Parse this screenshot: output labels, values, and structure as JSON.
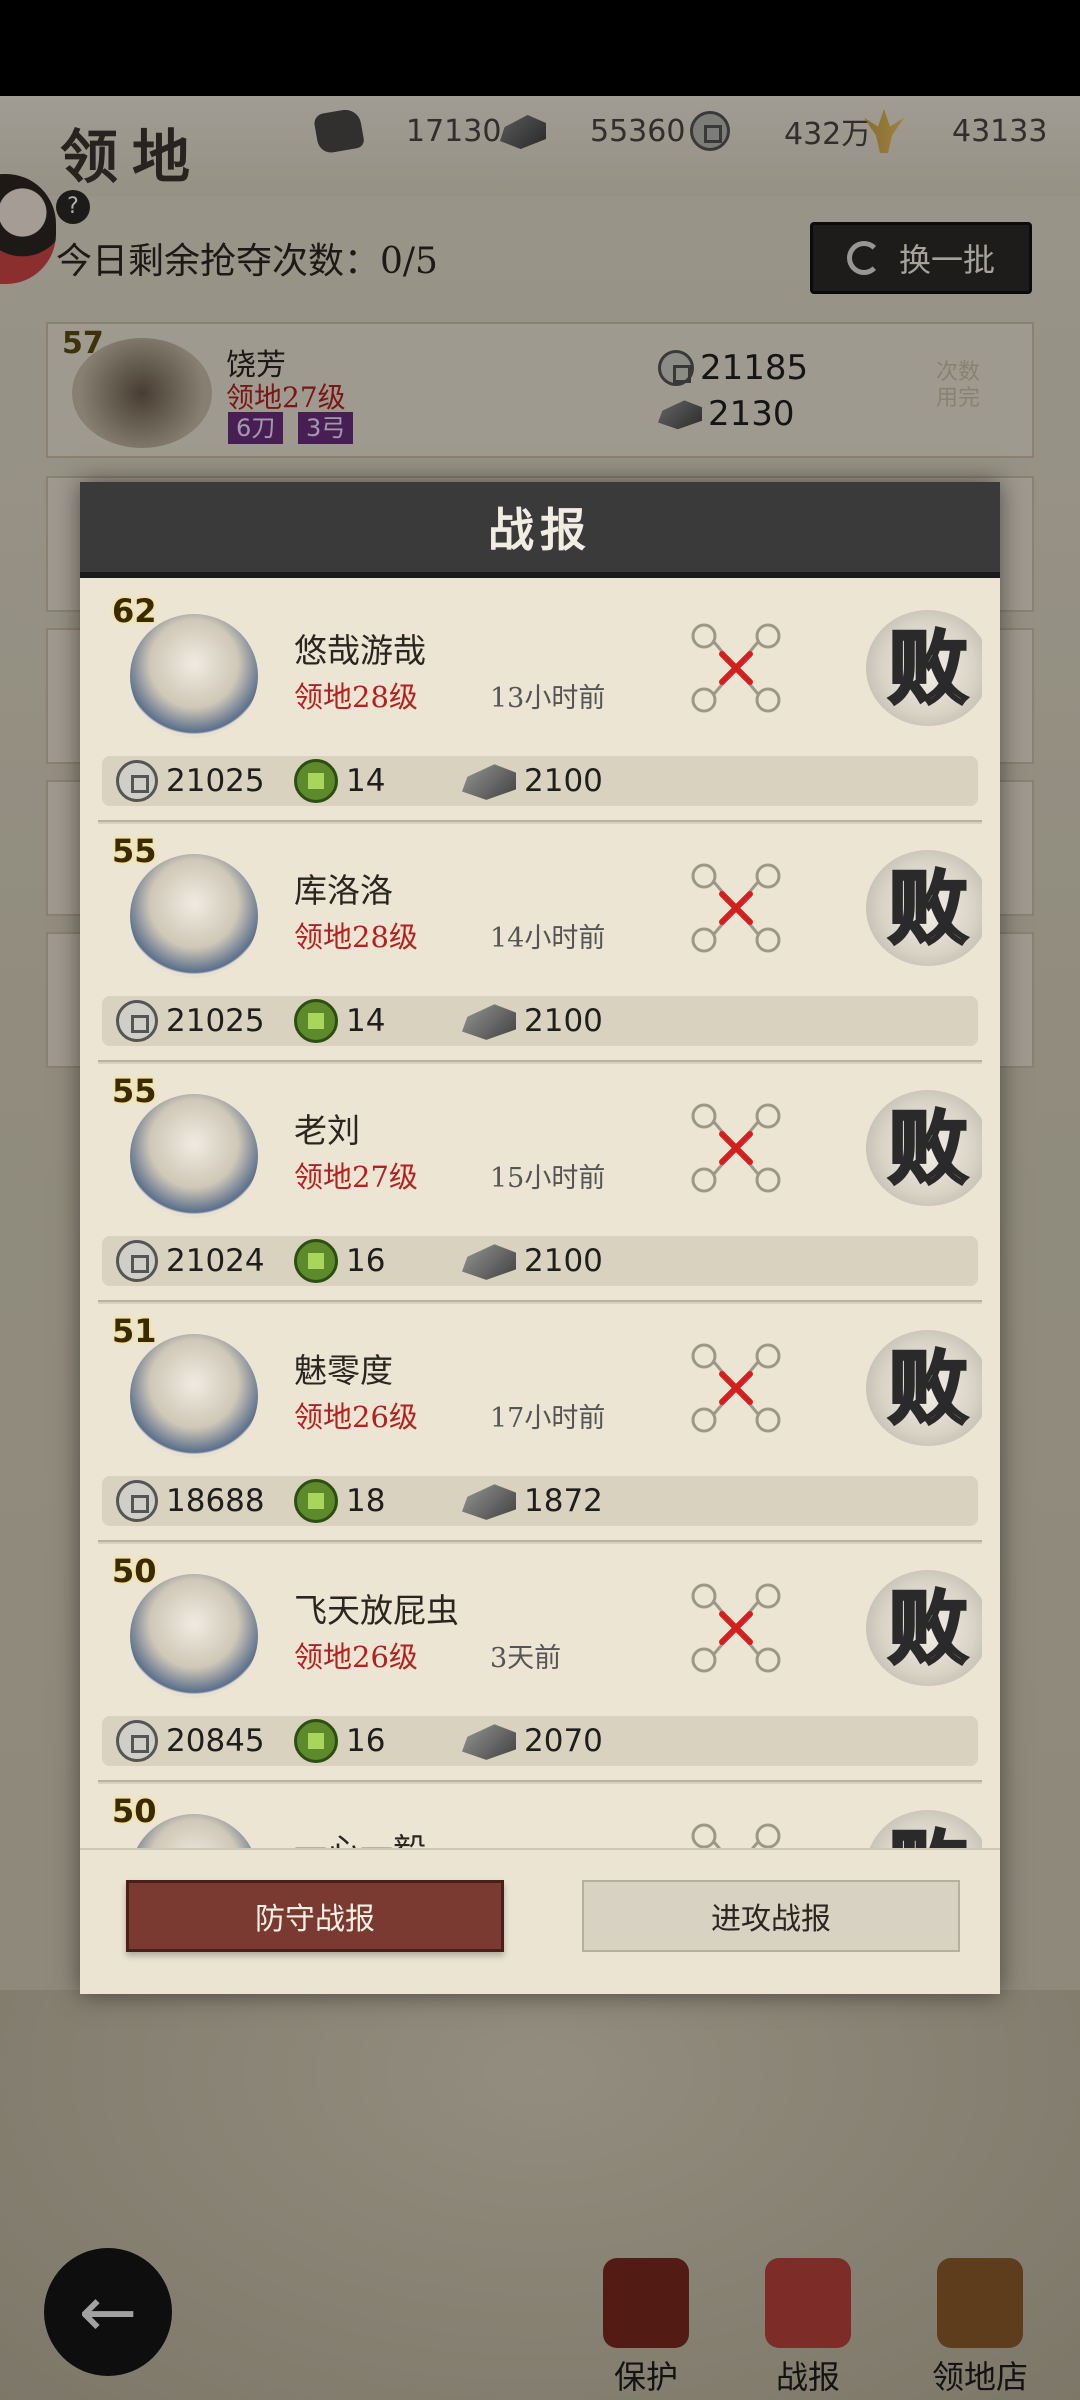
{
  "header": {
    "title": "领地",
    "resources": [
      {
        "icon": "ore-icon",
        "value": "17130"
      },
      {
        "icon": "ingot-icon",
        "value": "55360"
      },
      {
        "icon": "coin-icon",
        "value": "432万"
      },
      {
        "icon": "wheat-icon",
        "value": "43133"
      }
    ],
    "help": "?",
    "attempts_text": "今日剩余抢夺次数：0/5",
    "refresh_label": "换一批"
  },
  "background_row": {
    "level": "57",
    "name": "饶芳",
    "territory": "领地27级",
    "tags": [
      "6刀",
      "3弓"
    ],
    "coins": "21185",
    "ingots": "2130",
    "status": "次数用完"
  },
  "modal": {
    "title": "战报",
    "entries": [
      {
        "level": "62",
        "name": "悠哉游哉",
        "territory": "领地28级",
        "time": "13小时前",
        "result": "败",
        "coins": "21025",
        "jade": "14",
        "ingots": "2100"
      },
      {
        "level": "55",
        "name": "库洛洛",
        "territory": "领地28级",
        "time": "14小时前",
        "result": "败",
        "coins": "21025",
        "jade": "14",
        "ingots": "2100"
      },
      {
        "level": "55",
        "name": "老刘",
        "territory": "领地27级",
        "time": "15小时前",
        "result": "败",
        "coins": "21024",
        "jade": "16",
        "ingots": "2100"
      },
      {
        "level": "51",
        "name": "魅零度",
        "territory": "领地26级",
        "time": "17小时前",
        "result": "败",
        "coins": "18688",
        "jade": "18",
        "ingots": "1872"
      },
      {
        "level": "50",
        "name": "飞天放屁虫",
        "territory": "领地26级",
        "time": "3天前",
        "result": "败",
        "coins": "20845",
        "jade": "16",
        "ingots": "2070"
      },
      {
        "level": "50",
        "name": "一心一毅",
        "territory": "",
        "time": "",
        "result": "败",
        "coins": "",
        "jade": "",
        "ingots": ""
      }
    ],
    "tab_defense": "防守战报",
    "tab_attack": "进攻战报"
  },
  "bottom_nav": [
    {
      "label": "保护",
      "icon": "shield-icon"
    },
    {
      "label": "战报",
      "icon": "battle-report-icon"
    },
    {
      "label": "领地店",
      "icon": "shop-icon"
    }
  ],
  "colors": {
    "accent_red": "#b4211e",
    "active_tab": "#7a3a32",
    "header_dark": "#3a3a3a"
  }
}
